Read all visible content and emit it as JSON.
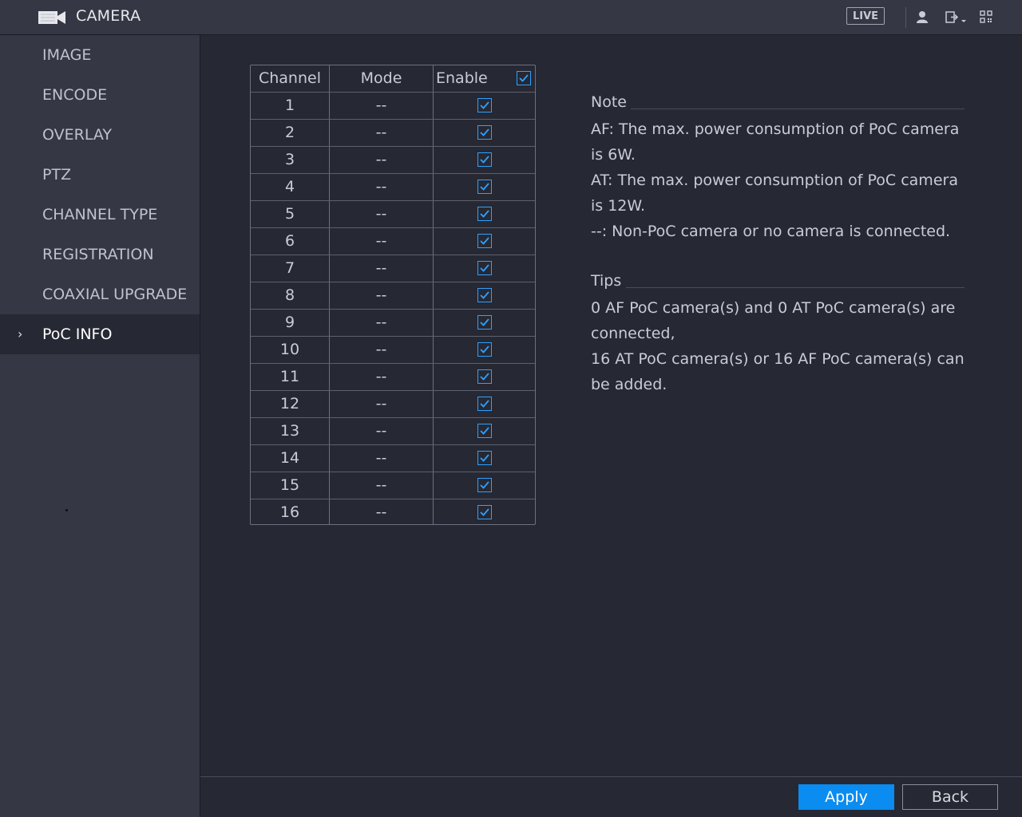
{
  "header": {
    "title": "CAMERA",
    "live_label": "LIVE",
    "icons": [
      "camera-icon",
      "user-icon",
      "logout-icon",
      "qr-code-icon"
    ]
  },
  "sidebar": {
    "items": [
      {
        "label": "IMAGE"
      },
      {
        "label": "ENCODE"
      },
      {
        "label": "OVERLAY"
      },
      {
        "label": "PTZ"
      },
      {
        "label": "CHANNEL TYPE"
      },
      {
        "label": "REGISTRATION"
      },
      {
        "label": "COAXIAL UPGRADE"
      },
      {
        "label": "PoC INFO",
        "active": true
      }
    ]
  },
  "table": {
    "headers": {
      "channel": "Channel",
      "mode": "Mode",
      "enable": "Enable"
    },
    "enable_all": true,
    "rows": [
      {
        "channel": "1",
        "mode": "--",
        "enabled": true
      },
      {
        "channel": "2",
        "mode": "--",
        "enabled": true
      },
      {
        "channel": "3",
        "mode": "--",
        "enabled": true
      },
      {
        "channel": "4",
        "mode": "--",
        "enabled": true
      },
      {
        "channel": "5",
        "mode": "--",
        "enabled": true
      },
      {
        "channel": "6",
        "mode": "--",
        "enabled": true
      },
      {
        "channel": "7",
        "mode": "--",
        "enabled": true
      },
      {
        "channel": "8",
        "mode": "--",
        "enabled": true
      },
      {
        "channel": "9",
        "mode": "--",
        "enabled": true
      },
      {
        "channel": "10",
        "mode": "--",
        "enabled": true
      },
      {
        "channel": "11",
        "mode": "--",
        "enabled": true
      },
      {
        "channel": "12",
        "mode": "--",
        "enabled": true
      },
      {
        "channel": "13",
        "mode": "--",
        "enabled": true
      },
      {
        "channel": "14",
        "mode": "--",
        "enabled": true
      },
      {
        "channel": "15",
        "mode": "--",
        "enabled": true
      },
      {
        "channel": "16",
        "mode": "--",
        "enabled": true
      }
    ]
  },
  "note": {
    "title": "Note",
    "lines": [
      "AF: The max. power consumption of PoC camera",
      "is 6W.",
      "AT: The max. power consumption of PoC camera",
      "is 12W.",
      "--: Non-PoC camera or no camera is connected."
    ]
  },
  "tips": {
    "title": "Tips",
    "lines": [
      "0 AF PoC camera(s) and 0 AT PoC camera(s) are",
      "connected,",
      "16 AT PoC camera(s) or 16 AF PoC camera(s) can",
      "be added."
    ]
  },
  "buttons": {
    "apply": "Apply",
    "back": "Back"
  },
  "colors": {
    "accent": "#0a8cf0",
    "checkbox": "#2fa0ff",
    "background": "#262833",
    "panel": "#353744"
  }
}
